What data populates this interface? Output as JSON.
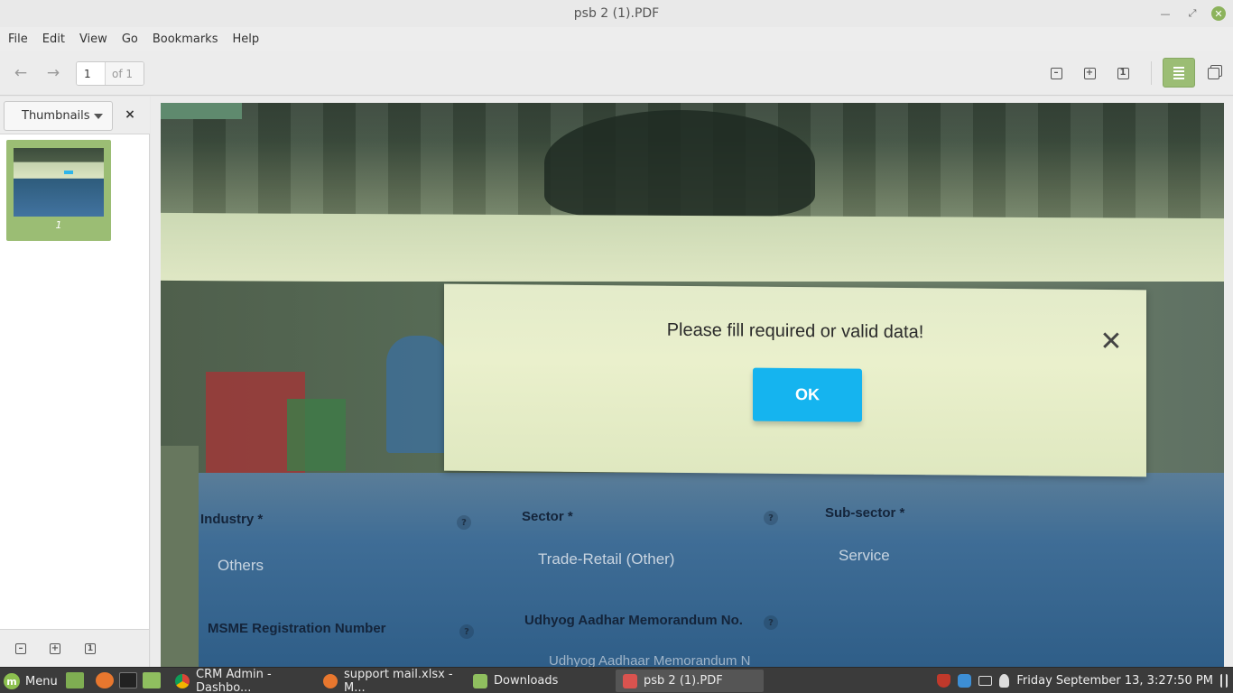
{
  "window": {
    "title": "psb 2 (1).PDF"
  },
  "menubar": {
    "items": [
      "File",
      "Edit",
      "View",
      "Go",
      "Bookmarks",
      "Help"
    ]
  },
  "toolbar": {
    "page_value": "1",
    "page_of": "of 1",
    "best_fit_label": "1"
  },
  "sidebar": {
    "dropdown_label": "Thumbnails",
    "close_glyph": "×",
    "thumbnail_label": "1"
  },
  "document": {
    "dialog": {
      "message": "Please fill required or valid data!",
      "ok_label": "OK",
      "close_glyph": "✕"
    },
    "form": {
      "industry_label": "Industry *",
      "industry_value": "Others",
      "sector_label": "Sector *",
      "sector_value": "Trade-Retail (Other)",
      "subsector_label": "Sub-sector *",
      "subsector_value": "Service",
      "msme_label": "MSME Registration Number",
      "udhyog_label": "Udhyog Aadhar Memorandum No.",
      "udhyog_value_partial": "Udhyog Aadhaar Memorandum N",
      "help_glyph": "?"
    }
  },
  "taskbar": {
    "menu_label": "Menu",
    "items": [
      {
        "label": "CRM Admin - Dashbo...",
        "icon": "chrome-icon"
      },
      {
        "label": "support mail.xlsx - M...",
        "icon": "spreadsheet-icon"
      },
      {
        "label": "Downloads",
        "icon": "folder-icon"
      },
      {
        "label": "psb 2 (1).PDF",
        "icon": "pdf-viewer-icon"
      }
    ],
    "clock": "Friday September 13,  3:27:50 PM"
  },
  "colors": {
    "accent": "#9bbd74",
    "ok_button": "#15b4ef",
    "taskbar": "#3b3b3b"
  }
}
